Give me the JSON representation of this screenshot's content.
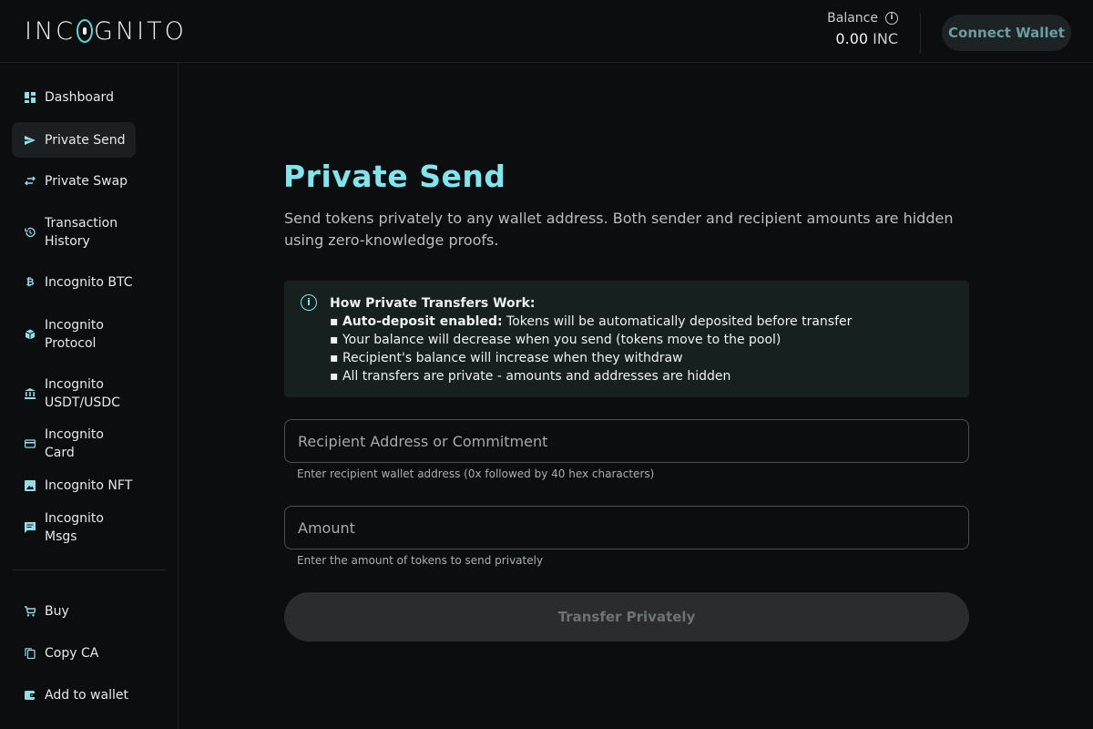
{
  "header": {
    "logo_text_1": "INC",
    "logo_text_2": "GNITO",
    "balance_label": "Balance",
    "balance_value": "0.00",
    "balance_unit": "INC",
    "connect_wallet": "Connect Wallet"
  },
  "sidebar": {
    "items": [
      {
        "label": "Dashboard",
        "icon": "dashboard-icon"
      },
      {
        "label": "Private Send",
        "icon": "send-icon",
        "active": true
      },
      {
        "label": "Private Swap",
        "icon": "swap-icon"
      },
      {
        "label": "Transaction History",
        "icon": "history-icon"
      },
      {
        "label": "Incognito BTC",
        "icon": "bitcoin-icon"
      },
      {
        "label": "Incognito Protocol",
        "icon": "protocol-icon"
      },
      {
        "label": "Incognito USDT/USDC",
        "icon": "bank-icon"
      },
      {
        "label": "Incognito Card",
        "icon": "card-icon"
      },
      {
        "label": "Incognito NFT",
        "icon": "image-icon"
      },
      {
        "label": "Incognito Msgs",
        "icon": "message-icon"
      }
    ],
    "bottom_items": [
      {
        "label": "Buy",
        "icon": "cart-icon"
      },
      {
        "label": "Copy CA",
        "icon": "copy-icon"
      },
      {
        "label": "Add to wallet",
        "icon": "wallet-icon"
      }
    ]
  },
  "main": {
    "title": "Private Send",
    "subtitle": "Send tokens privately to any wallet address. Both sender and recipient amounts are hidden using zero-knowledge proofs.",
    "info": {
      "heading": "How Private Transfers Work:",
      "line1_bold": "Auto-deposit enabled:",
      "line1_rest": " Tokens will be automatically deposited before transfer",
      "line2": "Your balance will decrease when you send (tokens move to the pool)",
      "line3": "Recipient's balance will increase when they withdraw",
      "line4": "All transfers are private - amounts and addresses are hidden"
    },
    "recipient": {
      "placeholder": "Recipient Address or Commitment",
      "value": "",
      "helper": "Enter recipient wallet address (0x followed by 40 hex characters)"
    },
    "amount": {
      "placeholder": "Amount",
      "value": "",
      "helper": "Enter the amount of tokens to send privately"
    },
    "transfer_button": "Transfer Privately"
  },
  "colors": {
    "accent": "#7fe6ee",
    "background": "#0c0d0e",
    "info_box": "#15201f"
  }
}
